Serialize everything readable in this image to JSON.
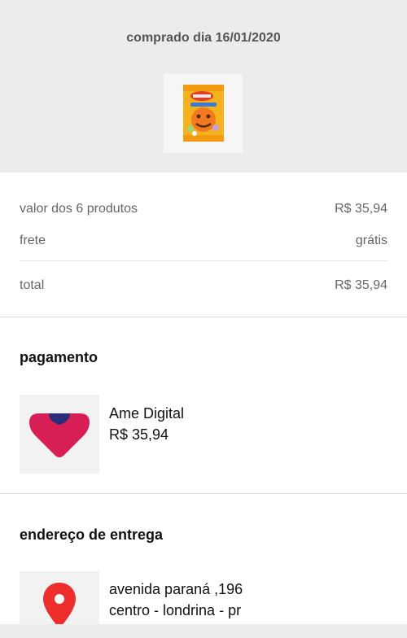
{
  "header": {
    "purchase_date": "comprado dia 16/01/2020",
    "product_image_icon": "product-package-image"
  },
  "summary": {
    "products_label": "valor dos 6 produtos",
    "products_value": "R$ 35,94",
    "shipping_label": "frete",
    "shipping_value": "grátis",
    "total_label": "total",
    "total_value": "R$ 35,94"
  },
  "payment": {
    "title": "pagamento",
    "method_name": "Ame Digital",
    "amount": "R$ 35,94",
    "icon": "ame-digital-logo"
  },
  "address": {
    "title": "endereço de entrega",
    "line1": "avenida paraná ,196",
    "line2": "centro - londrina - pr",
    "icon": "location-pin-icon"
  },
  "colors": {
    "header_bg": "#ececec",
    "ame_red": "#d81f55",
    "ame_navy": "#2d2d7a",
    "pin_red": "#ee2d2d",
    "package_yellow": "#f6b21c"
  }
}
